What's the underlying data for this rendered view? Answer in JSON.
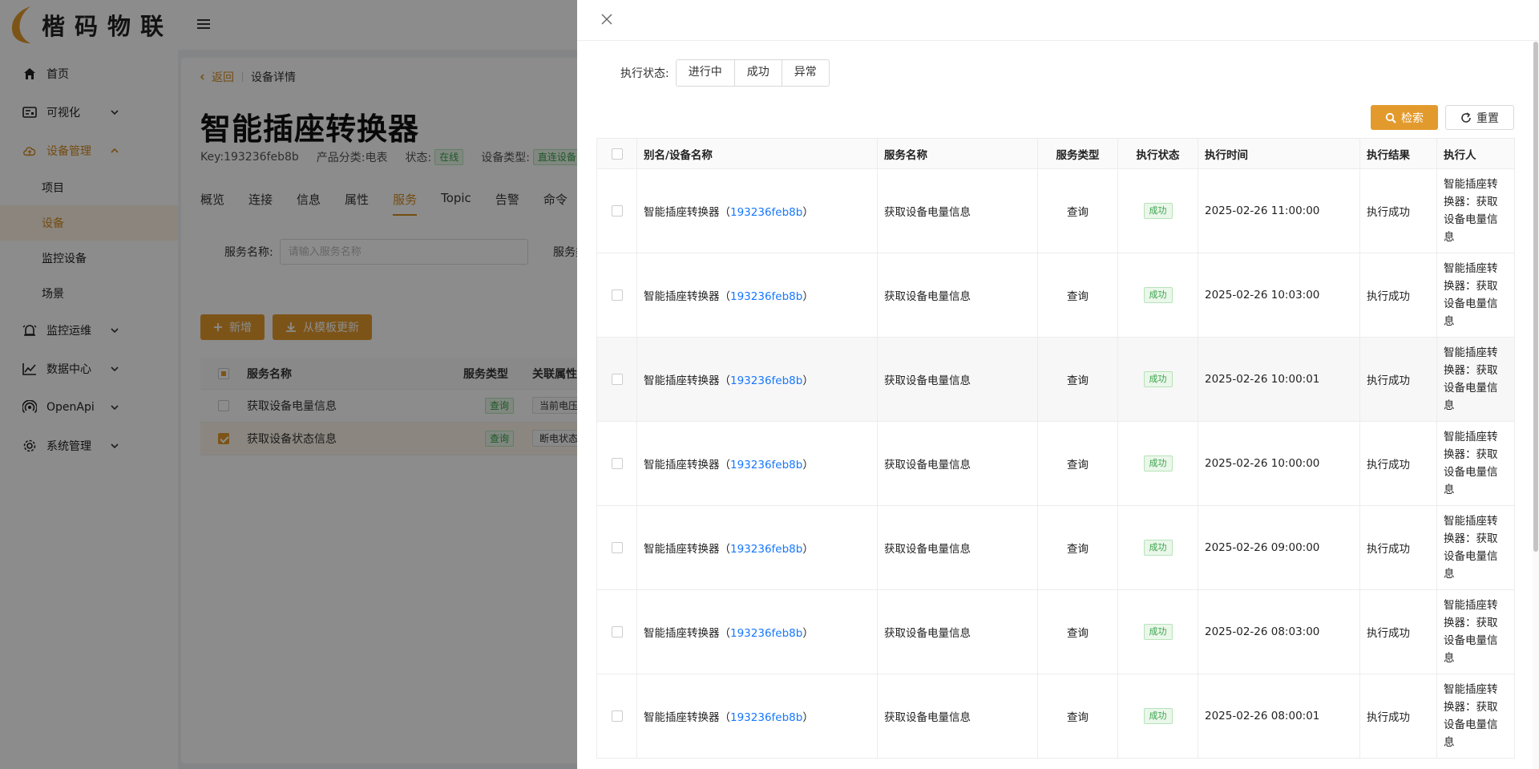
{
  "app": {
    "logo_text": "楷码物联",
    "colors": {
      "accent": "#e39a2d",
      "link": "#1677ff",
      "success": "#3aa34a"
    }
  },
  "sidebar": {
    "items": [
      {
        "label": "首页",
        "icon": "home-icon"
      },
      {
        "label": "可视化",
        "icon": "dashboard-icon"
      },
      {
        "label": "设备管理",
        "icon": "cloud-device-icon",
        "expanded": true,
        "children": [
          {
            "label": "项目"
          },
          {
            "label": "设备",
            "active": true
          },
          {
            "label": "监控设备"
          },
          {
            "label": "场景"
          }
        ]
      },
      {
        "label": "监控运维",
        "icon": "alarm-icon"
      },
      {
        "label": "数据中心",
        "icon": "chart-line-icon"
      },
      {
        "label": "OpenApi",
        "icon": "api-icon"
      },
      {
        "label": "系统管理",
        "icon": "gear-icon"
      }
    ]
  },
  "breadcrumb": {
    "back": "返回",
    "current": "设备详情"
  },
  "device": {
    "title": "智能插座转换器",
    "key": "Key:193236feb8b",
    "category": "产品分类:电表",
    "status_label": "状态:",
    "status_value": "在线",
    "type_label": "设备类型:",
    "type_value": "直连设备"
  },
  "tabs": [
    "概览",
    "连接",
    "信息",
    "属性",
    "服务",
    "Topic",
    "告警",
    "命令"
  ],
  "filter": {
    "label": "服务名称:",
    "placeholder": "请输入服务名称",
    "label2": "服务类型:"
  },
  "actions": {
    "add": "新增",
    "update_from_template": "从模板更新"
  },
  "services_table": {
    "headers": [
      "服务名称",
      "服务类型",
      "关联属性"
    ],
    "rows": [
      {
        "name": "获取设备电量信息",
        "type": "查询",
        "attr": "当前电压",
        "checked": false
      },
      {
        "name": "获取设备状态信息",
        "type": "查询",
        "attr": "断电状态",
        "checked": true
      }
    ]
  },
  "drawer": {
    "status_filter_label": "执行状态:",
    "status_options": [
      "进行中",
      "成功",
      "异常"
    ],
    "search": "检索",
    "reset": "重置",
    "headers": [
      "别名/设备名称",
      "服务名称",
      "服务类型",
      "执行状态",
      "执行时间",
      "执行结果",
      "执行人"
    ],
    "rows": [
      {
        "name": "智能插座转换器（",
        "id": "193236feb8b",
        "close": "）",
        "service": "获取设备电量信息",
        "type": "查询",
        "status": "成功",
        "time": "2025-02-26 11:00:00",
        "result": "执行成功",
        "executor": "智能插座转换器：获取设备电量信息"
      },
      {
        "name": "智能插座转换器（",
        "id": "193236feb8b",
        "close": "）",
        "service": "获取设备电量信息",
        "type": "查询",
        "status": "成功",
        "time": "2025-02-26 10:03:00",
        "result": "执行成功",
        "executor": "智能插座转换器：获取设备电量信息"
      },
      {
        "name": "智能插座转换器（",
        "id": "193236feb8b",
        "close": "）",
        "service": "获取设备电量信息",
        "type": "查询",
        "status": "成功",
        "time": "2025-02-26 10:00:01",
        "result": "执行成功",
        "executor": "智能插座转换器：获取设备电量信息"
      },
      {
        "name": "智能插座转换器（",
        "id": "193236feb8b",
        "close": "）",
        "service": "获取设备电量信息",
        "type": "查询",
        "status": "成功",
        "time": "2025-02-26 10:00:00",
        "result": "执行成功",
        "executor": "智能插座转换器：获取设备电量信息"
      },
      {
        "name": "智能插座转换器（",
        "id": "193236feb8b",
        "close": "）",
        "service": "获取设备电量信息",
        "type": "查询",
        "status": "成功",
        "time": "2025-02-26 09:00:00",
        "result": "执行成功",
        "executor": "智能插座转换器：获取设备电量信息"
      },
      {
        "name": "智能插座转换器（",
        "id": "193236feb8b",
        "close": "）",
        "service": "获取设备电量信息",
        "type": "查询",
        "status": "成功",
        "time": "2025-02-26 08:03:00",
        "result": "执行成功",
        "executor": "智能插座转换器：获取设备电量信息"
      },
      {
        "name": "智能插座转换器（",
        "id": "193236feb8b",
        "close": "）",
        "service": "获取设备电量信息",
        "type": "查询",
        "status": "成功",
        "time": "2025-02-26 08:00:01",
        "result": "执行成功",
        "executor": "智能插座转换器：获取设备电量信息"
      }
    ]
  }
}
